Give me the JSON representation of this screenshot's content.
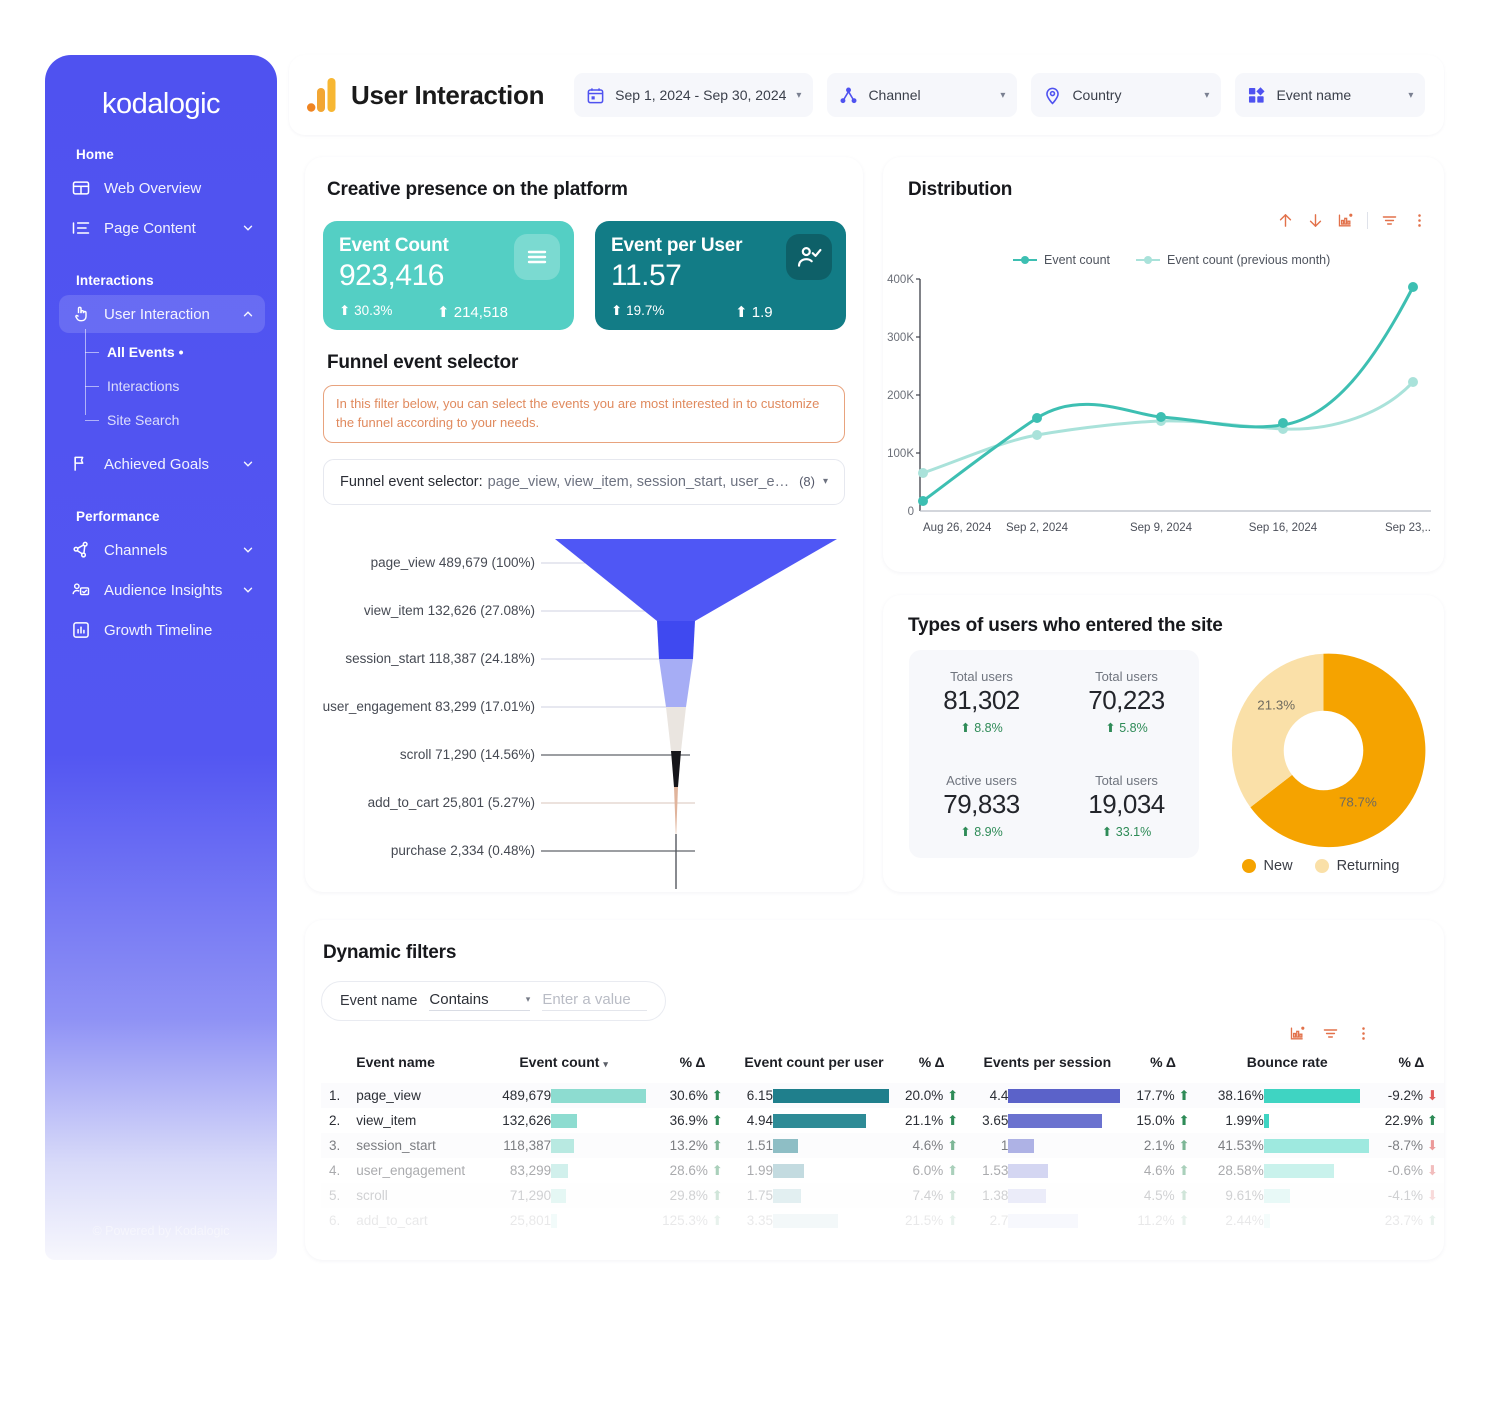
{
  "brand": {
    "name": "kodalogic",
    "footer": "© Powered by Kodalogic"
  },
  "sidebar": {
    "sections": [
      {
        "label": "Home",
        "items": [
          {
            "label": "Web Overview",
            "icon": "web-overview-icon",
            "expandable": false
          },
          {
            "label": "Page Content",
            "icon": "page-content-icon",
            "expandable": true,
            "chevron": "down"
          }
        ]
      },
      {
        "label": "Interactions",
        "items": [
          {
            "label": "User Interaction",
            "icon": "cursor-icon",
            "expandable": true,
            "chevron": "up",
            "active": true
          }
        ]
      },
      {
        "label": "Performance",
        "items": [
          {
            "label": "Channels",
            "icon": "channels-icon",
            "expandable": true,
            "chevron": "down"
          },
          {
            "label": "Audience Insights",
            "icon": "audience-icon",
            "expandable": true,
            "chevron": "down"
          },
          {
            "label": "Growth Timeline",
            "icon": "growth-icon",
            "expandable": false
          }
        ]
      }
    ],
    "achieved_goals": {
      "label": "Achieved Goals",
      "icon": "flag-icon",
      "chevron": "down"
    },
    "sub_items": [
      {
        "label": "All Events •",
        "current": true
      },
      {
        "label": "Interactions",
        "current": false
      },
      {
        "label": "Site Search",
        "current": false
      }
    ]
  },
  "header": {
    "title": "User Interaction",
    "logo_icon": "analytics-bars-icon",
    "filters": [
      {
        "label": "Sep 1, 2024 - Sep 30, 2024",
        "icon": "calendar-icon"
      },
      {
        "label": "Channel",
        "icon": "channel-node-icon"
      },
      {
        "label": "Country",
        "icon": "location-pin-icon"
      },
      {
        "label": "Event name",
        "icon": "grid-blocks-icon"
      }
    ]
  },
  "creative": {
    "title": "Creative presence on the platform",
    "kpis": [
      {
        "name": "Event Count",
        "value": "923,416",
        "delta": "30.3%",
        "absolute": "214,518",
        "icon": "menu-lines-icon",
        "color": "#54cfc4"
      },
      {
        "name": "Event per User",
        "value": "11.57",
        "delta": "19.7%",
        "absolute": "1.9",
        "icon": "user-check-icon",
        "color": "#127c86"
      }
    ],
    "funnel_title": "Funnel event selector",
    "funnel_note": "In this filter below, you can select the events you are most interested in to customize the funnel according to your needs.",
    "funnel_selector": {
      "label": "Funnel event selector:",
      "value": "page_view, view_item, session_start, user_engage...",
      "count": "(8)"
    }
  },
  "chart_data": [
    {
      "id": "distribution",
      "type": "line",
      "title": "Distribution",
      "legend": [
        {
          "name": "Event count",
          "color": "#3dbfb2"
        },
        {
          "name": "Event count (previous month)",
          "color": "#a9e2da"
        }
      ],
      "legend_position": "top-left",
      "x": [
        "Aug 26, 2024",
        "Sep 2, 2024",
        "Sep 9, 2024",
        "Sep 16, 2024",
        "Sep 23,.."
      ],
      "xlabel": "",
      "ylabel": "",
      "ytick_labels": [
        "0",
        "100K",
        "200K",
        "300K",
        "400K"
      ],
      "ylim": [
        0,
        400000
      ],
      "grid": false,
      "series": [
        {
          "name": "Event count",
          "values": [
            22000,
            160000,
            158000,
            153000,
            396000
          ]
        },
        {
          "name": "Event count (previous month)",
          "values": [
            65000,
            130000,
            148000,
            140000,
            223000
          ]
        }
      ],
      "toolbar_icons": [
        "arrow-up-icon",
        "arrow-down-icon",
        "chart-export-icon",
        "filter-icon",
        "more-vertical-icon"
      ]
    },
    {
      "id": "funnel",
      "type": "funnel",
      "title": "Funnel event selector",
      "steps": [
        {
          "label": "page_view 489,679 (100%)",
          "name": "page_view",
          "value": 489679,
          "pct": "100%",
          "color": "#4f57f5"
        },
        {
          "label": "view_item 132,626 (27.08%)",
          "name": "view_item",
          "value": 132626,
          "pct": "27.08%",
          "color": "#4f57f5"
        },
        {
          "label": "session_start 118,387 (24.18%)",
          "name": "session_start",
          "value": 118387,
          "pct": "24.18%",
          "color": "#a6adf5"
        },
        {
          "label": "user_engagement 83,299 (17.01%)",
          "name": "user_engagement",
          "value": 83299,
          "pct": "17.01%",
          "color": "#eae5e0"
        },
        {
          "label": "scroll 71,290 (14.56%)",
          "name": "scroll",
          "value": 71290,
          "pct": "14.56%",
          "color": "#16161a"
        },
        {
          "label": "add_to_cart 25,801 (5.27%)",
          "name": "add_to_cart",
          "value": 25801,
          "pct": "5.27%",
          "color": "#e0b49c"
        },
        {
          "label": "purchase 2,334 (0.48%)",
          "name": "purchase",
          "value": 2334,
          "pct": "0.48%",
          "color": "#55585f"
        }
      ]
    },
    {
      "id": "user-types-donut",
      "type": "pie",
      "title": "Types of users who entered the site",
      "labels": [
        "New",
        "Returning"
      ],
      "values": [
        78.7,
        21.3
      ],
      "value_labels": [
        "78.7%",
        "21.3%"
      ],
      "colors": [
        "#f5a300",
        "#fae0a8"
      ],
      "legend_position": "bottom"
    }
  ],
  "types": {
    "title": "Types of users who entered the site",
    "cells": [
      {
        "label": "Total users",
        "value": "81,302",
        "delta": "8.8%"
      },
      {
        "label": "Total users",
        "value": "70,223",
        "delta": "5.8%"
      },
      {
        "label": "Active users",
        "value": "79,833",
        "delta": "8.9%"
      },
      {
        "label": "Total users",
        "value": "19,034",
        "delta": "33.1%"
      }
    ]
  },
  "dynamic": {
    "title": "Dynamic filters",
    "filter": {
      "field_label": "Event name",
      "operator": "Contains",
      "value_placeholder": "Enter a value",
      "value": ""
    },
    "toolbar_icons": [
      "chart-export-icon",
      "filter-icon",
      "more-vertical-icon"
    ],
    "table": {
      "columns": [
        "Event name",
        "Event count",
        "% Δ",
        "Event count per user",
        "% Δ",
        "Events per session",
        "% Δ",
        "Bounce rate",
        "% Δ"
      ],
      "sort_column": "Event count",
      "rows": [
        {
          "idx": "1.",
          "name": "page_view",
          "event_count": "489,679",
          "event_count_d": "30.6%",
          "ecpu": "6.15",
          "ecpu_d": "20.0%",
          "eps": "4.4",
          "eps_d": "17.7%",
          "bounce": "38.16%",
          "bounce_d": "-9.2%",
          "bar_ec": 100,
          "bar_ecpu": 100,
          "bar_eps": 100,
          "bar_bounce": 92,
          "dir_ec": "up",
          "dir_ecpu": "up",
          "dir_eps": "up",
          "dir_bounce": "down"
        },
        {
          "idx": "2.",
          "name": "view_item",
          "event_count": "132,626",
          "event_count_d": "36.9%",
          "ecpu": "4.94",
          "ecpu_d": "21.1%",
          "eps": "3.65",
          "eps_d": "15.0%",
          "bounce": "1.99%",
          "bounce_d": "22.9%",
          "bar_ec": 27,
          "bar_ecpu": 80,
          "bar_eps": 84,
          "bar_bounce": 5,
          "dir_ec": "up",
          "dir_ecpu": "up",
          "dir_eps": "up",
          "dir_bounce": "up"
        },
        {
          "idx": "3.",
          "name": "session_start",
          "event_count": "118,387",
          "event_count_d": "13.2%",
          "ecpu": "1.51",
          "ecpu_d": "4.6%",
          "eps": "1",
          "eps_d": "2.1%",
          "bounce": "41.53%",
          "bounce_d": "-8.7%",
          "bar_ec": 24,
          "bar_ecpu": 25,
          "bar_eps": 24,
          "bar_bounce": 100,
          "dir_ec": "up",
          "dir_ecpu": "up",
          "dir_eps": "up",
          "dir_bounce": "down"
        },
        {
          "idx": "4.",
          "name": "user_engagement",
          "event_count": "83,299",
          "event_count_d": "28.6%",
          "ecpu": "1.99",
          "ecpu_d": "6.0%",
          "eps": "1.53",
          "eps_d": "4.6%",
          "bounce": "28.58%",
          "bounce_d": "-0.6%",
          "bar_ec": 17,
          "bar_ecpu": 32,
          "bar_eps": 36,
          "bar_bounce": 68,
          "dir_ec": "up",
          "dir_ecpu": "up",
          "dir_eps": "up",
          "dir_bounce": "down"
        },
        {
          "idx": "5.",
          "name": "scroll",
          "event_count": "71,290",
          "event_count_d": "29.8%",
          "ecpu": "1.75",
          "ecpu_d": "7.4%",
          "eps": "1.38",
          "eps_d": "4.5%",
          "bounce": "9.61%",
          "bounce_d": "-4.1%",
          "bar_ec": 15,
          "bar_ecpu": 28,
          "bar_eps": 34,
          "bar_bounce": 25,
          "dir_ec": "up",
          "dir_ecpu": "up",
          "dir_eps": "up",
          "dir_bounce": "down"
        },
        {
          "idx": "6.",
          "name": "add_to_cart",
          "event_count": "25,801",
          "event_count_d": "125.3%",
          "ecpu": "3.35",
          "ecpu_d": "21.5%",
          "eps": "2.7",
          "eps_d": "11.2%",
          "bounce": "2.44%",
          "bounce_d": "23.7%",
          "bar_ec": 6,
          "bar_ecpu": 56,
          "bar_eps": 62,
          "bar_bounce": 6,
          "dir_ec": "up",
          "dir_ecpu": "up",
          "dir_eps": "up",
          "dir_bounce": "up"
        }
      ]
    }
  },
  "colors": {
    "brand_purple": "#4f52f0",
    "teal_light": "#54cfc4",
    "teal_dark": "#127c86",
    "orange": "#f5a300",
    "orange_light": "#fae0a8",
    "accent_orange": "#e2714a",
    "green": "#2e8b57",
    "red": "#e05c5c"
  }
}
